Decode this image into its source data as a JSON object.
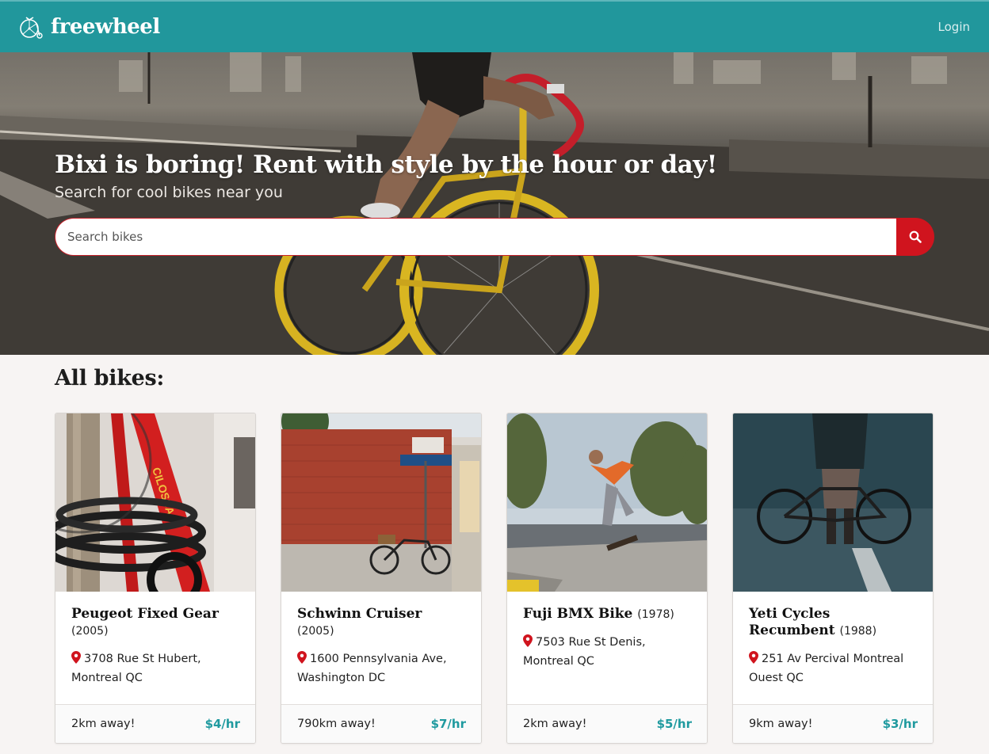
{
  "nav": {
    "brand": "freewheel",
    "login": "Login"
  },
  "hero": {
    "title": "Bixi is boring! Rent with style by the hour or day!",
    "subtitle": "Search for cool bikes near you",
    "search_placeholder": "Search bikes"
  },
  "section_title": "All bikes:",
  "colors": {
    "brand": "#21979c",
    "accent": "#d0141e",
    "price": "#1f9a9f"
  },
  "bikes": [
    {
      "name": "Peugeot Fixed Gear",
      "year": "(2005)",
      "address": "3708 Rue St Hubert, Montreal QC",
      "distance": "2km away!",
      "price": "$4/hr",
      "image": "red-bike-lock-photo"
    },
    {
      "name": "Schwinn Cruiser",
      "year": "(2005)",
      "address": "1600 Pennsylvania Ave, Washington DC",
      "distance": "790km away!",
      "price": "$7/hr",
      "image": "brick-wall-bike-photo"
    },
    {
      "name": "Fuji BMX Bike",
      "year": "(1978)",
      "address": "7503 Rue St Denis, Montreal QC",
      "distance": "2km away!",
      "price": "$5/hr",
      "image": "skatepark-photo"
    },
    {
      "name": "Yeti Cycles Recumbent",
      "year": "(1988)",
      "address": "251 Av Percival Montreal Ouest QC",
      "distance": "9km away!",
      "price": "$3/hr",
      "image": "rain-bike-photo"
    }
  ]
}
